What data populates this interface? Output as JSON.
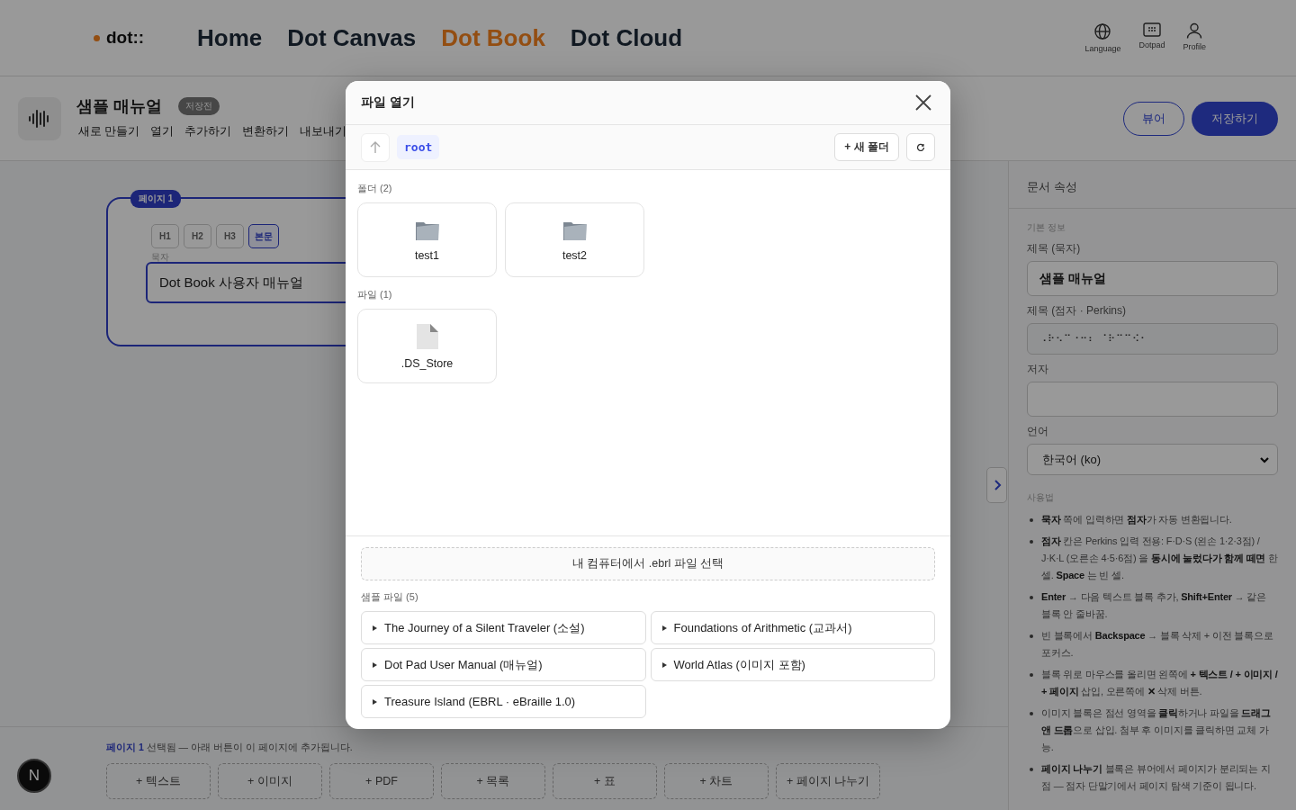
{
  "header": {
    "logo": "dot::",
    "nav": [
      {
        "label": "Home",
        "selected": false
      },
      {
        "label": "Dot Canvas",
        "selected": false
      },
      {
        "label": "Dot Book",
        "selected": true
      },
      {
        "label": "Dot Cloud",
        "selected": false
      }
    ],
    "actions": [
      {
        "kind": "language",
        "label": "Language"
      },
      {
        "kind": "dotpad",
        "label": "Dotpad"
      },
      {
        "kind": "profile",
        "label": "Profile"
      }
    ]
  },
  "toolbar": {
    "title": "샘플 매뉴얼",
    "badge": "저장전",
    "menu": [
      "새로 만들기",
      "열기",
      "추가하기",
      "변환하기",
      "내보내기"
    ],
    "viewer_button": "뷰어",
    "save_button": "저장하기"
  },
  "canvas": {
    "page_badge": "페이지 1",
    "block_types": [
      {
        "label": "H1",
        "selected": false
      },
      {
        "label": "H2",
        "selected": false
      },
      {
        "label": "H3",
        "selected": false
      },
      {
        "label": "본문",
        "selected": true
      }
    ],
    "field_label": "묵자",
    "field_value": "Dot Book 사용자 매뉴얼"
  },
  "bottom_bar": {
    "note": "**페이지 1** 선택됨 — 아래 버튼이 이 페이지에 추가됩니다.",
    "add_buttons": [
      "+ 텍스트",
      "+ 이미지",
      "+ PDF",
      "+ 목록",
      "+ 표",
      "+ 차트",
      "+ 페이지 나누기"
    ],
    "dev_badge": "N"
  },
  "properties": {
    "title": "문서 속성",
    "section": "기본 정보",
    "fields": [
      {
        "kind": "text",
        "label": "제목 (묵자)",
        "value": "샘플 매뉴얼"
      },
      {
        "kind": "braille",
        "label": "제목 (점자 · Perkins)",
        "value": "⠠⠗⠢⠉⠐⠒⠆ ⠈⠗⠉⠉⠪⠂"
      },
      {
        "kind": "text",
        "label": "저자"
      },
      {
        "kind": "select",
        "label": "언어",
        "value": "한국어 (ko)"
      }
    ],
    "usage_title": "사용법",
    "usage": [
      "**묵자** 쪽에 입력하면 **점자**가 자동 변환됩니다.",
      "**점자** 칸은 Perkins 입력 전용: F·D·S (왼손 1·2·3점) / J·K·L (오른손 4·5·6점) 을 **동시에 눌렀다가 함께 떼면** 한 셀. **Space** 는 빈 셀.",
      "**Enter** → 다음 텍스트 블록 추가, **Shift+Enter** → 같은 블록 안 줄바꿈.",
      "빈 블록에서 **Backspace** → 블록 삭제 + 이전 블록으로 포커스.",
      "블록 위로 마우스를 올리면 왼쪽에 **+ 텍스트 / + 이미지 / + 페이지** 삽입, 오른쪽에 **✕** 삭제 버튼.",
      "이미지 블록은 점선 영역을 **클릭**하거나 파일을 **드래그 앤 드롭**으로 삽입. 첨부 후 이미지를 클릭하면 교체 가능.",
      "**페이지 나누기** 블록은 뷰어에서 페이지가 분리되는 지점 — 점자 단말기에서 페이지 탐색 기준이 됩니다."
    ]
  },
  "modal": {
    "title": "파일 열기",
    "path": "root",
    "new_folder_button": "+ 새 폴더",
    "folders_label": "폴더 (2)",
    "folders": [
      "test1",
      "test2"
    ],
    "files_label": "파일 (1)",
    "files": [
      ".DS_Store"
    ],
    "local_button": "내 컴퓨터에서 .ebrl 파일 선택",
    "samples_label": "샘플 파일 (5)",
    "samples": [
      "The Journey of a Silent Traveler (소설)",
      "Foundations of Arithmetic (교과서)",
      "Dot Pad User Manual (매뉴얼)",
      "World Atlas (이미지 포함)",
      "Treasure Island (EBRL · eBraille 1.0)"
    ]
  }
}
